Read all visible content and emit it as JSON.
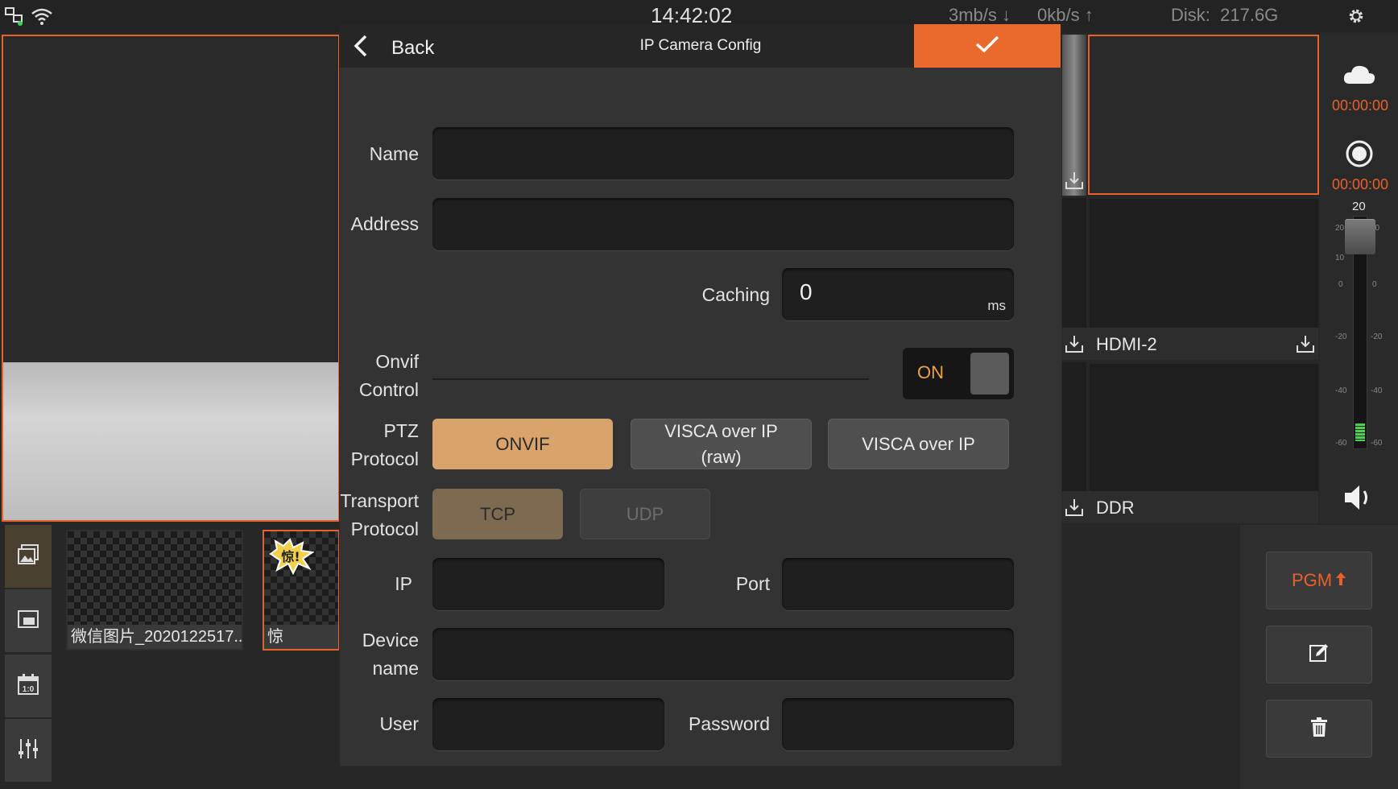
{
  "status_bar": {
    "time": "14:42:02",
    "download_rate": "3mb/s",
    "upload_rate": "0kb/s",
    "disk_label": "Disk:",
    "disk_value": "217.6G"
  },
  "thumbnails": [
    {
      "caption": "微信图片_2020122517..."
    },
    {
      "caption": "惊",
      "sticker_text": "惊!"
    }
  ],
  "dialog": {
    "back_label": "Back",
    "title": "IP Camera Config",
    "name_label": "Name",
    "name_value": "",
    "address_label": "Address",
    "address_value": "",
    "caching_label": "Caching",
    "caching_value": "0",
    "caching_unit": "ms",
    "onvif_label_1": "Onvif",
    "onvif_label_2": "Control",
    "onvif_toggle": "ON",
    "ptz_label_1": "PTZ",
    "ptz_label_2": "Protocol",
    "ptz_options": [
      "ONVIF",
      "VISCA over IP",
      "(raw)",
      "VISCA over IP"
    ],
    "ptz_selected": "ONVIF",
    "transport_label_1": "Transport",
    "transport_label_2": "Protocol",
    "transport_options": [
      "TCP",
      "UDP"
    ],
    "transport_selected": "TCP",
    "ip_label": "IP",
    "ip_value": "",
    "port_label": "Port",
    "port_value": "",
    "device_label_1": "Device",
    "device_label_2": "name",
    "device_value": "",
    "user_label": "User",
    "user_value": "",
    "password_label": "Password",
    "password_value": ""
  },
  "sources": [
    {
      "label": ""
    },
    {
      "label": "HDMI-2"
    },
    {
      "label": "DDR"
    }
  ],
  "side": {
    "stream_time": "00:00:00",
    "record_time": "00:00:00",
    "volume_value": "20",
    "vu_ticks_left": [
      "20",
      "10",
      "0",
      "-20",
      "-40",
      "-60"
    ],
    "vu_ticks_right": [
      "10",
      "0",
      "-20",
      "-40",
      "-60"
    ],
    "pgm_label": "PGM"
  },
  "colors": {
    "accent": "#ea6a2d",
    "selected_ptz": "#d8a46c",
    "selected_transport": "#7e6a50"
  }
}
